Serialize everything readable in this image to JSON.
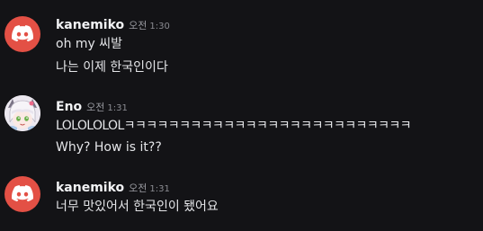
{
  "messages": [
    {
      "username": "kanemiko",
      "ampm": "오전",
      "time": "1:30",
      "avatar": "discord-logo-icon",
      "lines": [
        "oh my 씨발",
        "나는 이제 한국인이다"
      ]
    },
    {
      "username": "Eno",
      "ampm": "오전",
      "time": "1:31",
      "avatar": "anime-character-avatar",
      "lines": [
        "LOLOLOLOLㅋㅋㅋㅋㅋㅋㅋㅋㅋㅋㅋㅋㅋㅋㅋㅋㅋㅋㅋㅋㅋㅋㅋㅋㅋㅋ",
        "Why? How is it??"
      ]
    },
    {
      "username": "kanemiko",
      "ampm": "오전",
      "time": "1:31",
      "avatar": "discord-logo-icon",
      "lines": [
        "너무 맛있어서 한국인이 됐어요"
      ]
    }
  ],
  "colors": {
    "background": "#131316",
    "discord_avatar": "#e35045",
    "username": "#f2f3f5",
    "text": "#e4e5e8",
    "timestamp": "#8a8b91"
  }
}
